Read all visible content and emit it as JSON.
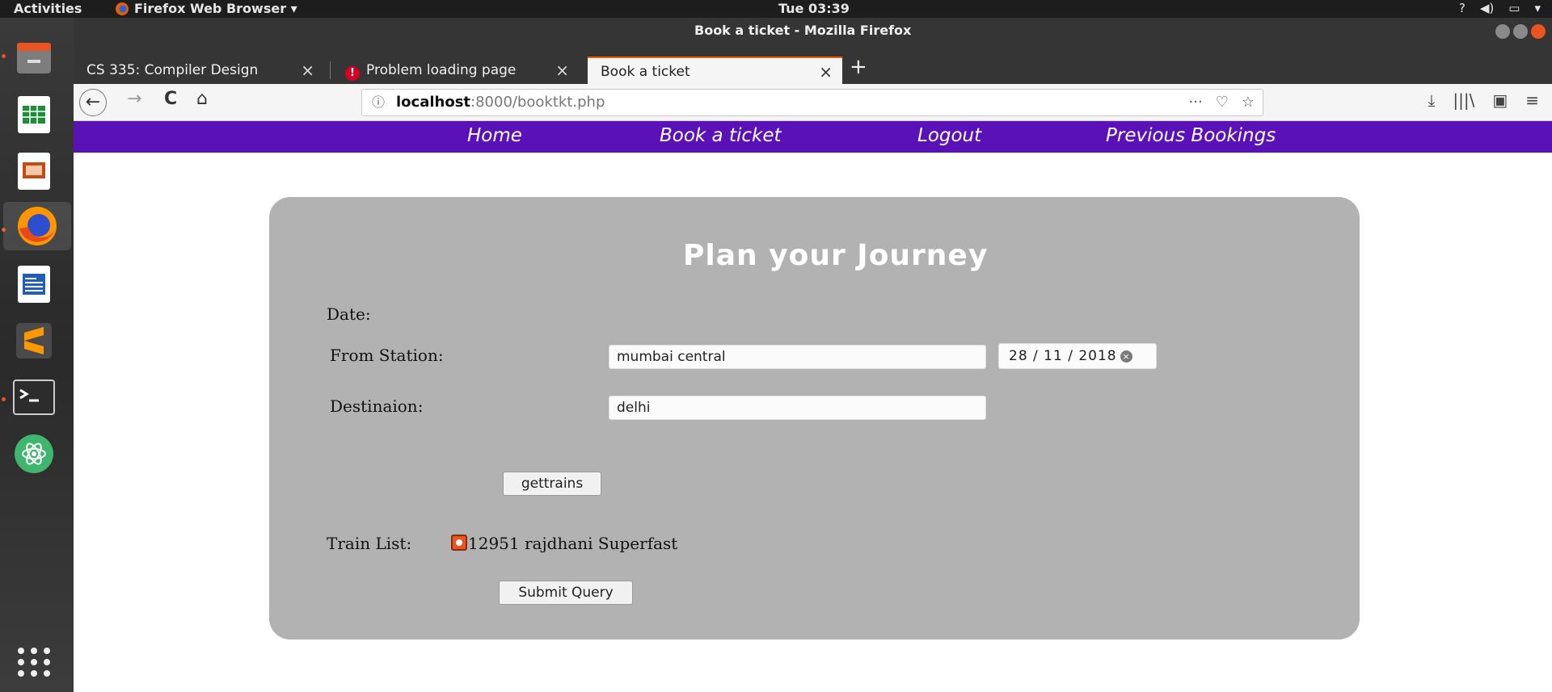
{
  "system": {
    "activities": "Activities",
    "app_menu": "Firefox Web Browser ▾",
    "clock": "Tue 03:39",
    "tray": [
      "?",
      "◀)",
      "▭",
      "▾"
    ]
  },
  "window": {
    "title": "Book a ticket - Mozilla Firefox"
  },
  "tabs": [
    {
      "label": "CS 335: Compiler Design"
    },
    {
      "label": "Problem loading page"
    },
    {
      "label": "Book a ticket"
    }
  ],
  "tab_close": "×",
  "new_tab": "+",
  "navbar": {
    "back": "←",
    "forward": "→",
    "reload": "C",
    "home": "⌂",
    "url_host": "localhost",
    "url_rest": ":8000/booktkt.php",
    "url_actions": [
      "···",
      "♡",
      "☆"
    ],
    "tools": [
      "⤓",
      "|||\\",
      "▣",
      "≡"
    ]
  },
  "site_nav": [
    {
      "label": "Home"
    },
    {
      "label": "Book a ticket"
    },
    {
      "label": "Logout"
    },
    {
      "label": "Previous Bookings"
    }
  ],
  "form": {
    "title": "Plan your Journey",
    "date_label": "Date:",
    "from_label": "From Station:",
    "from_value": "mumbai central",
    "date_value": "28 / 11 / 2018",
    "dest_label": "Destinaion:",
    "dest_value": "delhi",
    "gettrains_label": "gettrains",
    "train_list_label": "Train List:",
    "train_option": "12951 rajdhani Superfast",
    "submit_label": "Submit Query"
  },
  "colors": {
    "nav_purple": "#5a12b8",
    "panel_gray": "#b2b2b2",
    "tab_accent": "#e66000"
  }
}
